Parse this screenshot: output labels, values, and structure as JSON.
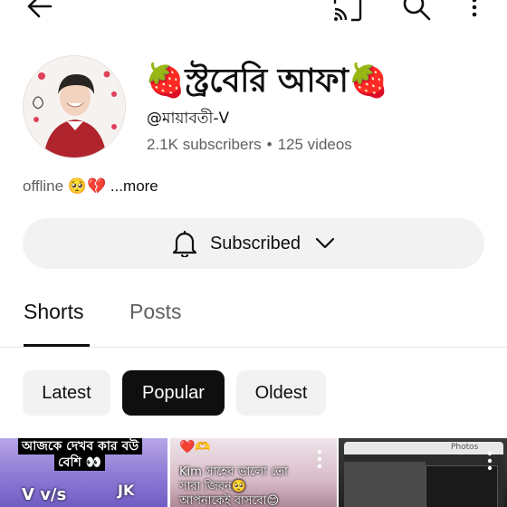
{
  "topbar": {
    "back_icon": "arrow-left-icon",
    "cast_icon": "cast-icon",
    "search_icon": "search-icon",
    "more_icon": "more-vertical-icon"
  },
  "channel": {
    "name": "🍓স্ট্রবেরি আফা🍓",
    "handle": "@মায়াবতী-V",
    "subscribers": "2.1K subscribers",
    "separator": "•",
    "videos": "125 videos",
    "about": "offline 🥺💔",
    "more_label": "...more"
  },
  "subscribe_button": {
    "label": "Subscribed",
    "icon": "bell-icon",
    "dropdown_icon": "chevron-down-icon"
  },
  "tabs": [
    {
      "label": "Shorts",
      "selected": true
    },
    {
      "label": "Posts",
      "selected": false
    }
  ],
  "chips": [
    {
      "label": "Latest",
      "selected": false
    },
    {
      "label": "Popular",
      "selected": true
    },
    {
      "label": "Oldest",
      "selected": false
    }
  ],
  "shorts": [
    {
      "caption_line1": "আজকে দেখব কার বউ",
      "caption_line2": "বেশি 👀",
      "overlay_left": "V   v/s",
      "overlay_right": "JK"
    },
    {
      "hearts": "❤️🫶",
      "caption_line1": "Kim সাহেব ভালো তো",
      "caption_line2": "সারা জিবন🥺",
      "caption_line3": "আপনাকেই বাসবো😊"
    },
    {
      "header": "Photos"
    }
  ],
  "colors": {
    "text_primary": "#0f0f0f",
    "text_secondary": "#606060",
    "chip_bg": "#f2f2f2",
    "chip_selected_bg": "#0f0f0f",
    "chip_selected_text": "#ffffff"
  }
}
